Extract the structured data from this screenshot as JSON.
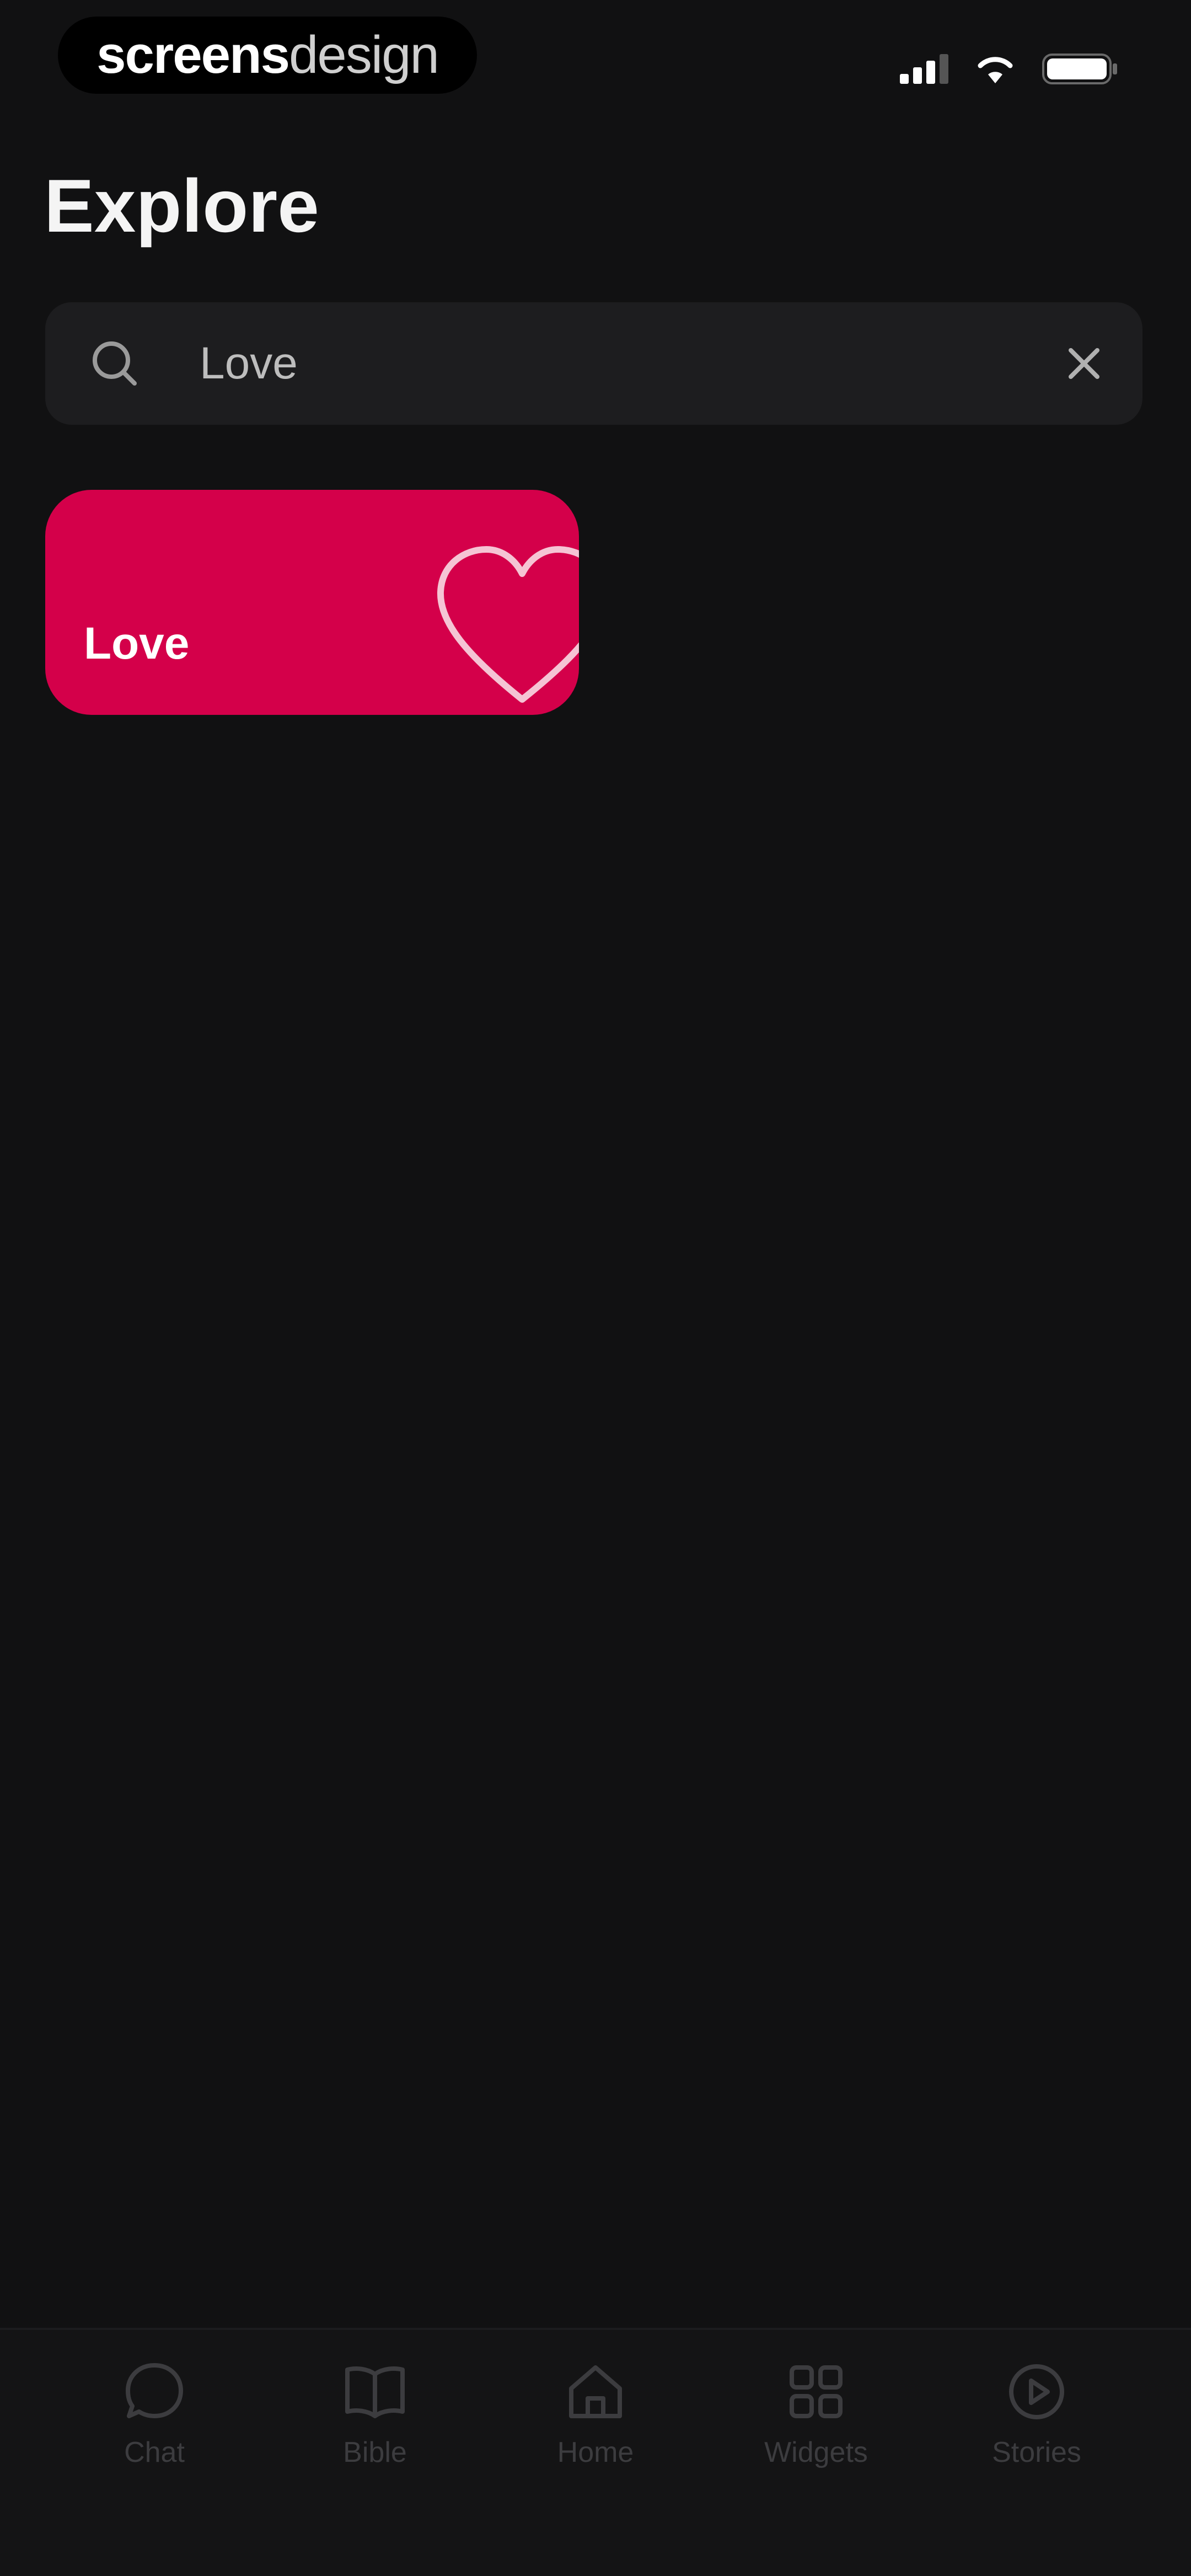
{
  "status_bar": {
    "brand_bold": "screens",
    "brand_light": "design"
  },
  "page": {
    "title": "Explore"
  },
  "search": {
    "value": "Love",
    "placeholder": ""
  },
  "categories": [
    {
      "label": "Love",
      "color": "#d4004a",
      "icon": "heart-icon"
    }
  ],
  "bottom_nav": {
    "items": [
      {
        "label": "Chat",
        "icon": "chat-bubble-icon"
      },
      {
        "label": "Bible",
        "icon": "open-book-icon"
      },
      {
        "label": "Home",
        "icon": "home-icon"
      },
      {
        "label": "Widgets",
        "icon": "grid-icon"
      },
      {
        "label": "Stories",
        "icon": "play-circle-icon"
      }
    ]
  },
  "colors": {
    "background": "#111112",
    "accent": "#d4004a",
    "search_bg": "#1d1d1f",
    "nav_inactive": "#3c3c3f"
  }
}
